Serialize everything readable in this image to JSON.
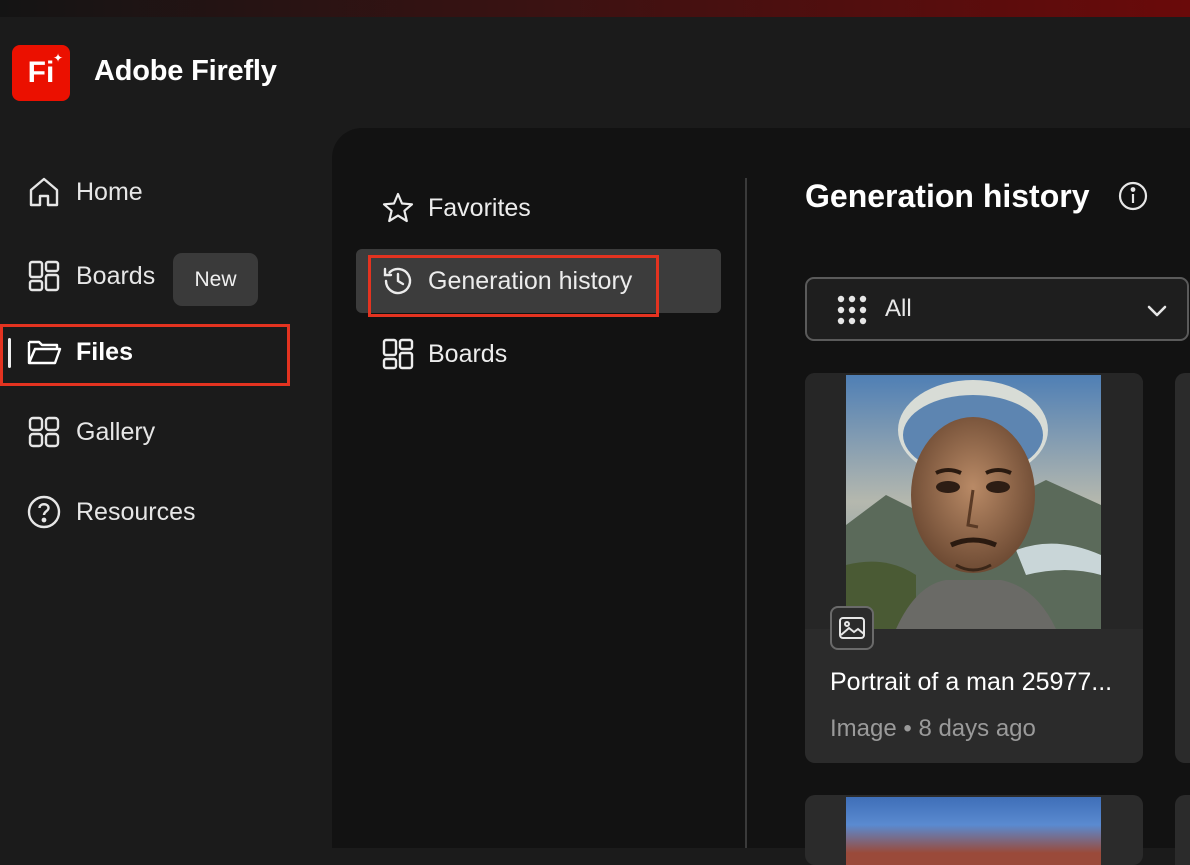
{
  "app": {
    "name": "Adobe Firefly",
    "logo_text": "Fi"
  },
  "nav": {
    "items": [
      {
        "label": "Home",
        "icon": "home-icon"
      },
      {
        "label": "Boards",
        "icon": "boards-icon",
        "badge": "New"
      },
      {
        "label": "Files",
        "icon": "folder-icon",
        "active": true
      },
      {
        "label": "Gallery",
        "icon": "gallery-icon"
      },
      {
        "label": "Resources",
        "icon": "help-circle-icon"
      }
    ]
  },
  "subnav": {
    "items": [
      {
        "label": "Favorites",
        "icon": "star-icon"
      },
      {
        "label": "Generation history",
        "icon": "history-icon",
        "selected": true
      },
      {
        "label": "Boards",
        "icon": "boards-icon"
      }
    ]
  },
  "main": {
    "title": "Generation history",
    "filter": {
      "value": "All"
    },
    "cards": [
      {
        "title": "Portrait of a man 25977...",
        "meta": "Image • 8 days ago"
      }
    ]
  },
  "colors": {
    "brand": "#eb1000",
    "highlight": "#e33320"
  }
}
